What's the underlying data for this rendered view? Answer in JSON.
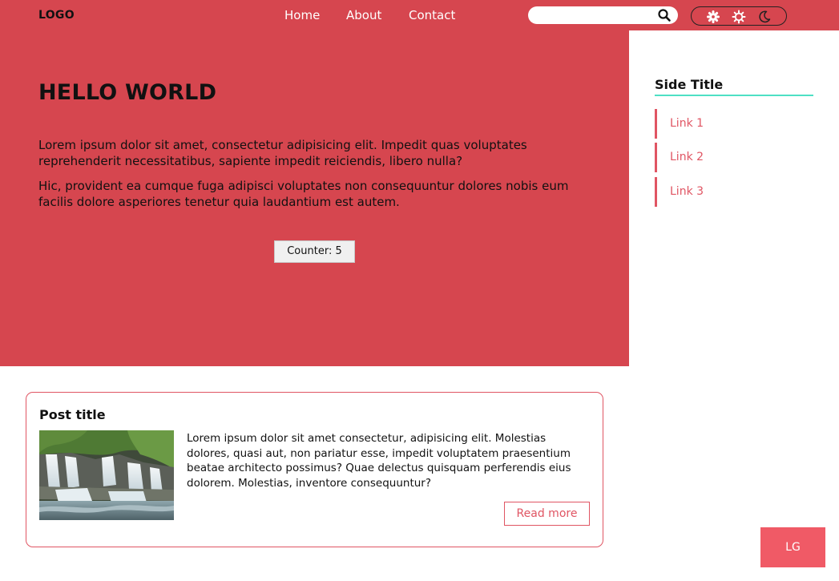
{
  "header": {
    "logo": "LOGO",
    "nav": [
      "Home",
      "About",
      "Contact"
    ],
    "search": {
      "value": "",
      "placeholder": "",
      "icon": "search-icon"
    },
    "theme_options": [
      "gear-icon",
      "sun-icon",
      "moon-icon"
    ]
  },
  "hero": {
    "title": "HELLO WORLD",
    "paragraphs": [
      "Lorem ipsum dolor sit amet, consectetur adipisicing elit. Impedit quas voluptates reprehenderit necessitatibus, sapiente impedit reiciendis, libero nulla?",
      "Hic, provident ea cumque fuga adipisci voluptates non consequuntur dolores nobis eum facilis dolore asperiores tenetur quia laudantium est autem."
    ],
    "counter_label": "Counter: 5"
  },
  "sidebar": {
    "title": "Side Title",
    "links": [
      "Link 1",
      "Link 2",
      "Link 3"
    ]
  },
  "post": {
    "title": "Post title",
    "text": "Lorem ipsum dolor sit amet consectetur, adipisicing elit. Molestias dolores, quasi aut, non pariatur esse, impedit voluptatem praesentium beatae architecto possimus? Quae delectus quisquam perferendis eius dolorem. Molestias, inventore consequuntur?",
    "read_more": "Read more"
  },
  "badge": "LG",
  "colors": {
    "primary": "#d6464f",
    "accent": "#e05563",
    "rule": "#4fe0c4",
    "badge": "#f05a66"
  }
}
